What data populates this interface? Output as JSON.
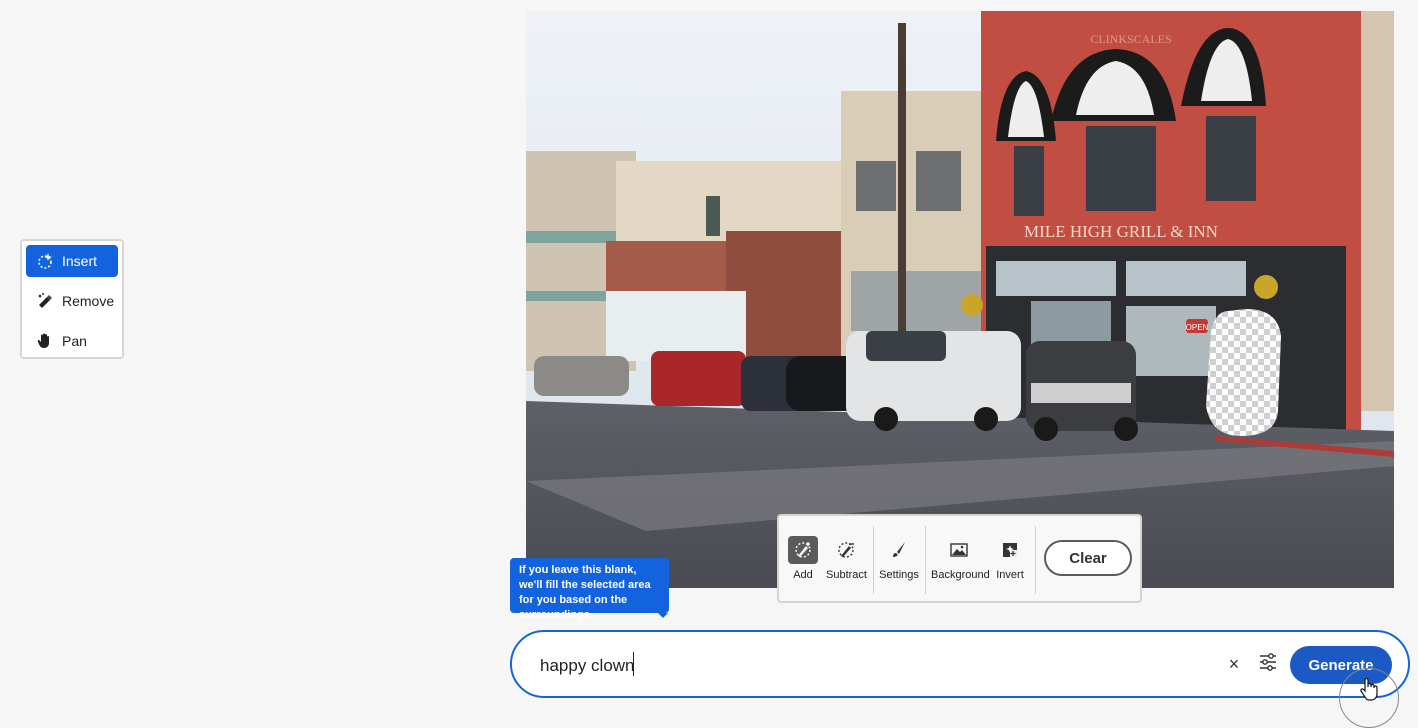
{
  "tools": {
    "items": [
      {
        "label": "Insert",
        "icon": "insert-sparkle-icon",
        "active": true
      },
      {
        "label": "Remove",
        "icon": "remove-eraser-icon",
        "active": false
      },
      {
        "label": "Pan",
        "icon": "hand-icon",
        "active": false
      }
    ]
  },
  "photo": {
    "sign_text": "MILE HIGH GRILL & INN",
    "upper_text": "CLINKSCALES",
    "open_sign": "OPEN"
  },
  "tooltip": {
    "text": "If you leave this blank, we'll fill the selected area for you based on the surroundings."
  },
  "mask_toolbar": {
    "add_label": "Add",
    "subtract_label": "Subtract",
    "settings_label": "Settings",
    "background_label": "Background",
    "invert_label": "Invert",
    "clear_label": "Clear"
  },
  "prompt": {
    "value": "happy clown",
    "clear_symbol": "×",
    "generate_label": "Generate"
  },
  "colors": {
    "accent": "#1363df",
    "generate": "#1b5ac4"
  }
}
